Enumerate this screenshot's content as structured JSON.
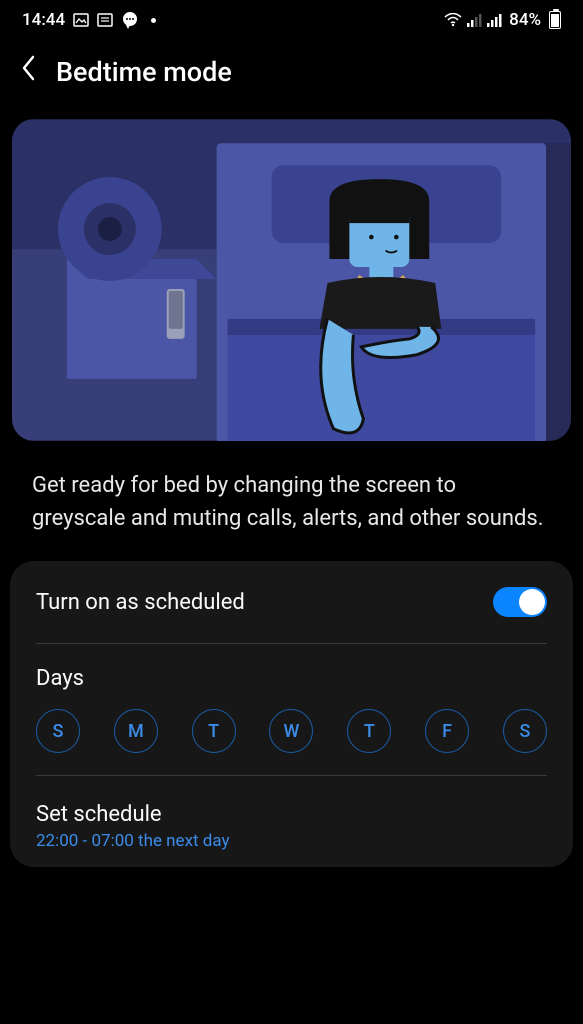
{
  "status": {
    "time": "14:44",
    "battery": "84%"
  },
  "header": {
    "title": "Bedtime mode"
  },
  "description": "Get ready for bed by changing the screen to greyscale and muting calls, alerts, and other sounds.",
  "settings": {
    "toggle_label": "Turn on as scheduled",
    "toggle_on": true,
    "days_label": "Days",
    "days": [
      "S",
      "M",
      "T",
      "W",
      "T",
      "F",
      "S"
    ],
    "schedule_label": "Set schedule",
    "schedule_value": "22:00 - 07:00 the next day"
  }
}
